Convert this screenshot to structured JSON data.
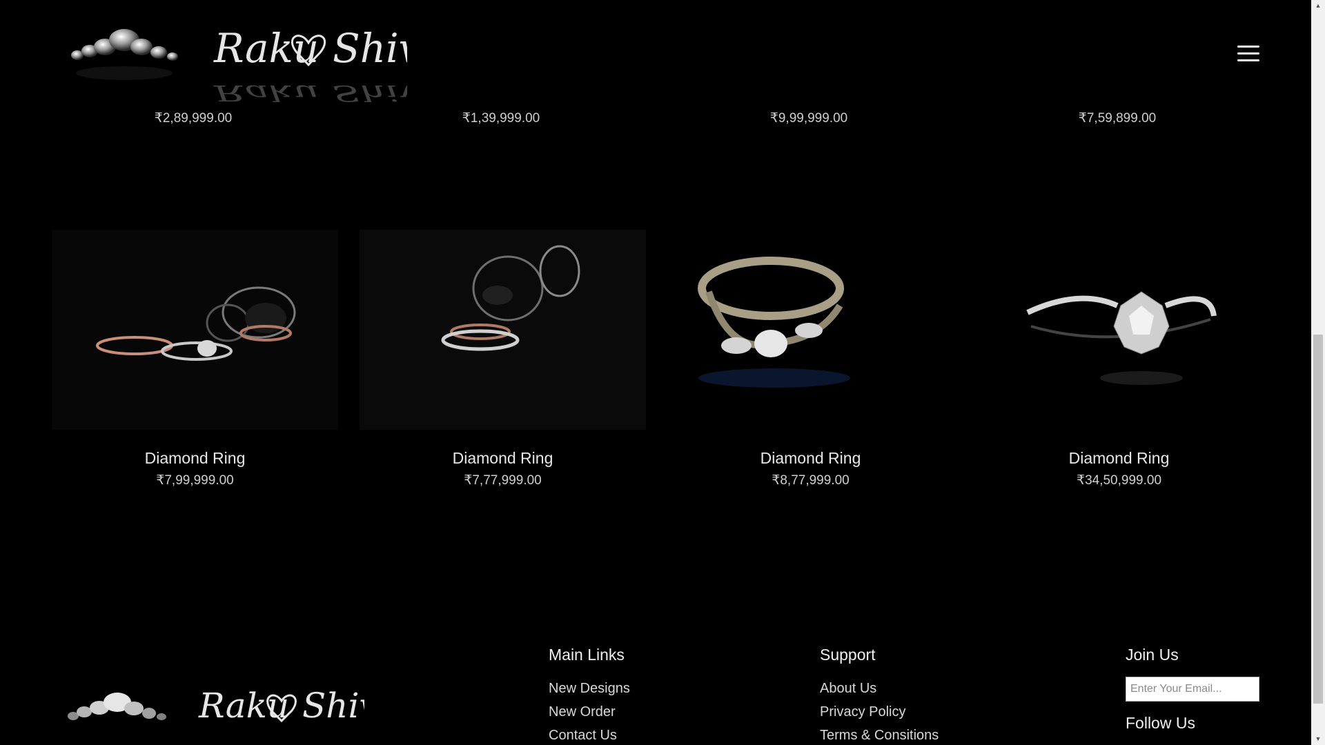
{
  "brand": {
    "logo_text": "Raku ♡ Shivu"
  },
  "header": {
    "menu_icon": "hamburger-menu-icon"
  },
  "top_row_prices": [
    "₹2,89,999.00",
    "₹1,39,999.00",
    "₹9,99,999.00",
    "₹7,59,899.00"
  ],
  "products": [
    {
      "name": "Diamond Ring",
      "price": "₹7,99,999.00"
    },
    {
      "name": "Diamond Ring",
      "price": "₹7,77,999.00"
    },
    {
      "name": "Diamond Ring",
      "price": "₹8,77,999.00"
    },
    {
      "name": "Diamond Ring",
      "price": "₹34,50,999.00"
    }
  ],
  "footer": {
    "main_links": {
      "title": "Main Links",
      "items": [
        "New Designs",
        "New Order",
        "Contact Us"
      ]
    },
    "support": {
      "title": "Support",
      "items": [
        "About Us",
        "Privacy Policy",
        "Terms & Consitions"
      ]
    },
    "join": {
      "title": "Join Us",
      "email_placeholder": "Enter Your Email...",
      "follow_title": "Follow Us"
    }
  },
  "colors": {
    "background": "#000000",
    "text": "#e6e6e6",
    "muted": "#cfcfcf"
  }
}
